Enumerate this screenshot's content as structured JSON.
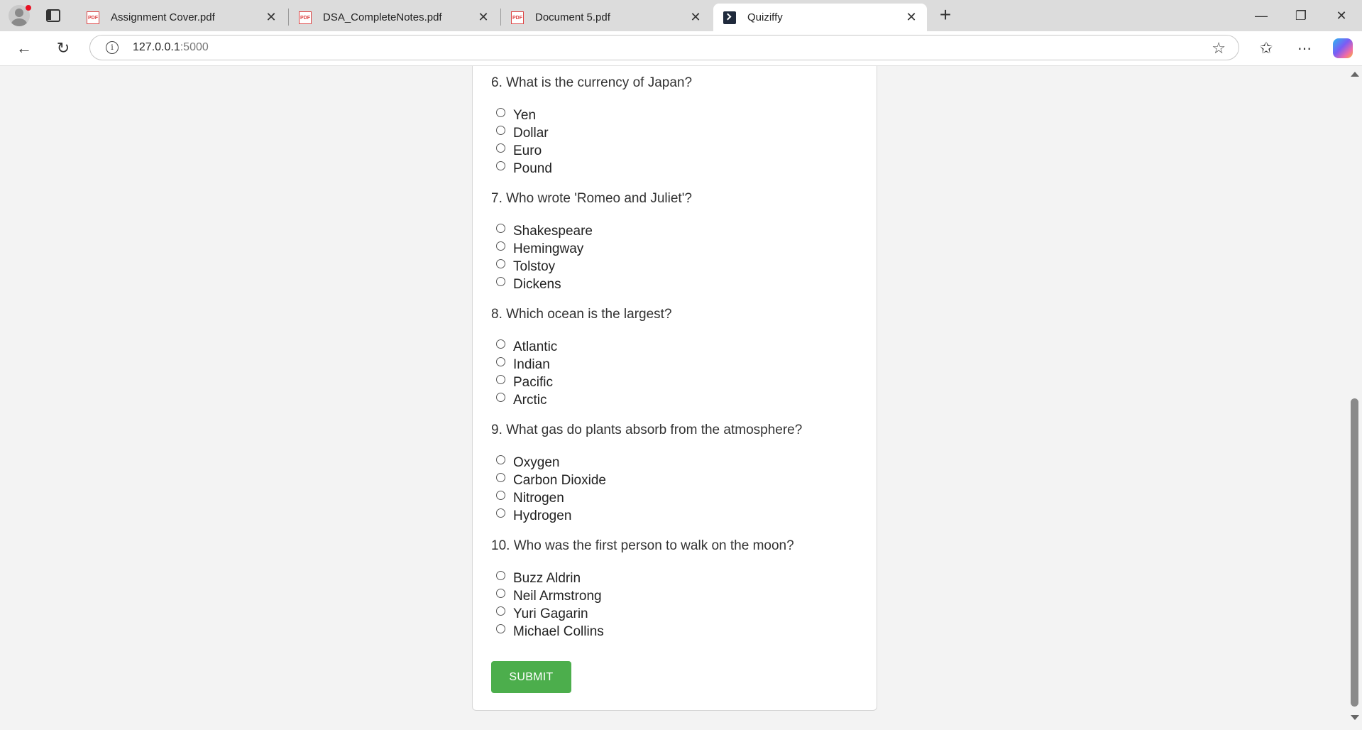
{
  "browser": {
    "tabs": [
      {
        "title": "Assignment Cover.pdf",
        "icon": "pdf-icon",
        "active": false
      },
      {
        "title": "DSA_CompleteNotes.pdf",
        "icon": "pdf-icon",
        "active": false
      },
      {
        "title": "Document 5.pdf",
        "icon": "pdf-icon",
        "active": false
      },
      {
        "title": "Quiziffy",
        "icon": "terminal-icon",
        "active": true
      }
    ],
    "url_host": "127.0.0.1",
    "url_port": ":5000"
  },
  "quiz": {
    "questions": [
      {
        "text": "6. What is the currency of Japan?",
        "options": [
          "Yen",
          "Dollar",
          "Euro",
          "Pound"
        ]
      },
      {
        "text": "7. Who wrote 'Romeo and Juliet'?",
        "options": [
          "Shakespeare",
          "Hemingway",
          "Tolstoy",
          "Dickens"
        ]
      },
      {
        "text": "8. Which ocean is the largest?",
        "options": [
          "Atlantic",
          "Indian",
          "Pacific",
          "Arctic"
        ]
      },
      {
        "text": "9. What gas do plants absorb from the atmosphere?",
        "options": [
          "Oxygen",
          "Carbon Dioxide",
          "Nitrogen",
          "Hydrogen"
        ]
      },
      {
        "text": "10. Who was the first person to walk on the moon?",
        "options": [
          "Buzz Aldrin",
          "Neil Armstrong",
          "Yuri Gagarin",
          "Michael Collins"
        ]
      }
    ],
    "submit_label": "SUBMIT"
  },
  "colors": {
    "submit": "#4cae4c",
    "tabstrip": "#dcdcdc",
    "page_bg": "#f3f3f3"
  }
}
